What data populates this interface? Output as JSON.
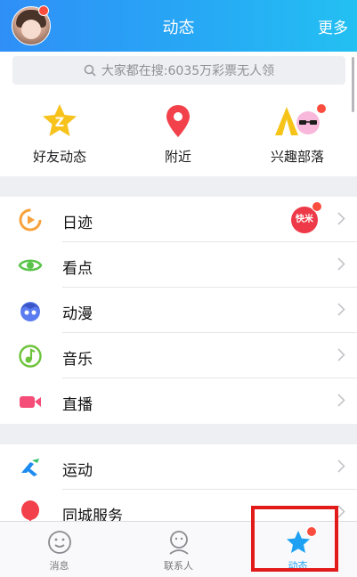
{
  "header": {
    "title": "动态",
    "more_label": "更多"
  },
  "search": {
    "placeholder_text": "大家都在搜:6035万彩票无人领"
  },
  "quick_links": [
    {
      "label": "好友动态",
      "icon": "friend-feed-icon"
    },
    {
      "label": "附近",
      "icon": "location-pin-icon"
    },
    {
      "label": "兴趣部落",
      "icon": "tribe-icon"
    }
  ],
  "menu_group_1": [
    {
      "label": "日迹",
      "icon": "daily-trace-icon",
      "badge": "快米"
    },
    {
      "label": "看点",
      "icon": "eye-icon"
    },
    {
      "label": "动漫",
      "icon": "anime-icon"
    },
    {
      "label": "音乐",
      "icon": "music-icon"
    },
    {
      "label": "直播",
      "icon": "live-camera-icon"
    }
  ],
  "menu_group_2": [
    {
      "label": "运动",
      "icon": "running-icon"
    },
    {
      "label": "同城服务",
      "icon": "balloon-icon"
    }
  ],
  "tabbar": [
    {
      "label": "消息",
      "icon": "message-smile-icon",
      "active": false
    },
    {
      "label": "联系人",
      "icon": "contacts-icon",
      "active": false
    },
    {
      "label": "动态",
      "icon": "star-icon",
      "active": true
    }
  ],
  "colors": {
    "brand_blue": "#1ea1f2",
    "notify_red": "#fb4d3d",
    "highlight_red": "#e21a1a"
  }
}
